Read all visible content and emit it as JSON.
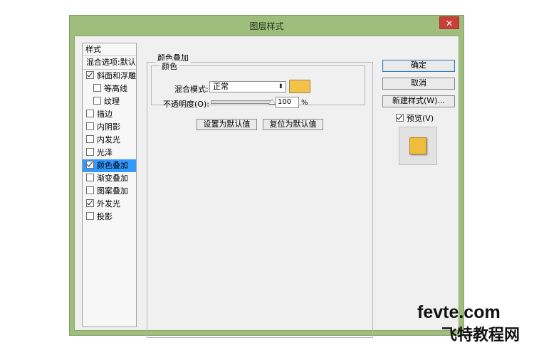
{
  "window": {
    "title": "图层样式",
    "close_label": "✕"
  },
  "style_list": {
    "header": "样式",
    "blend_options": "混合选项:默认",
    "items": [
      {
        "label": "斜面和浮雕",
        "checked": true,
        "sub": false,
        "selected": false
      },
      {
        "label": "等高线",
        "checked": false,
        "sub": true,
        "selected": false
      },
      {
        "label": "纹理",
        "checked": false,
        "sub": true,
        "selected": false
      },
      {
        "label": "描边",
        "checked": false,
        "sub": false,
        "selected": false
      },
      {
        "label": "内阴影",
        "checked": false,
        "sub": false,
        "selected": false
      },
      {
        "label": "内发光",
        "checked": false,
        "sub": false,
        "selected": false
      },
      {
        "label": "光泽",
        "checked": false,
        "sub": false,
        "selected": false
      },
      {
        "label": "颜色叠加",
        "checked": true,
        "sub": false,
        "selected": true
      },
      {
        "label": "渐变叠加",
        "checked": false,
        "sub": false,
        "selected": false
      },
      {
        "label": "图案叠加",
        "checked": false,
        "sub": false,
        "selected": false
      },
      {
        "label": "外发光",
        "checked": true,
        "sub": false,
        "selected": false
      },
      {
        "label": "投影",
        "checked": false,
        "sub": false,
        "selected": false
      }
    ]
  },
  "color_overlay": {
    "section_title": "颜色叠加",
    "group_title": "颜色",
    "blend_mode_label": "混合模式:",
    "blend_mode_value": "正常",
    "overlay_color": "#f2c24a",
    "opacity_label": "不透明度(O):",
    "opacity_value": "100",
    "opacity_unit": "%",
    "opacity_fraction": 1.0,
    "set_default_label": "设置为默认值",
    "reset_default_label": "复位为默认值"
  },
  "buttons": {
    "ok": "确定",
    "cancel": "取消",
    "new_style": "新建样式(W)...",
    "preview_label": "预览(V)",
    "preview_checked": true
  },
  "colors": {
    "window_frame": "#9fbe7e",
    "selection": "#3399ff",
    "preview_fill": "#f0bc3e"
  },
  "watermark": {
    "line1": "fevte.com",
    "line2": "飞特教程网"
  }
}
